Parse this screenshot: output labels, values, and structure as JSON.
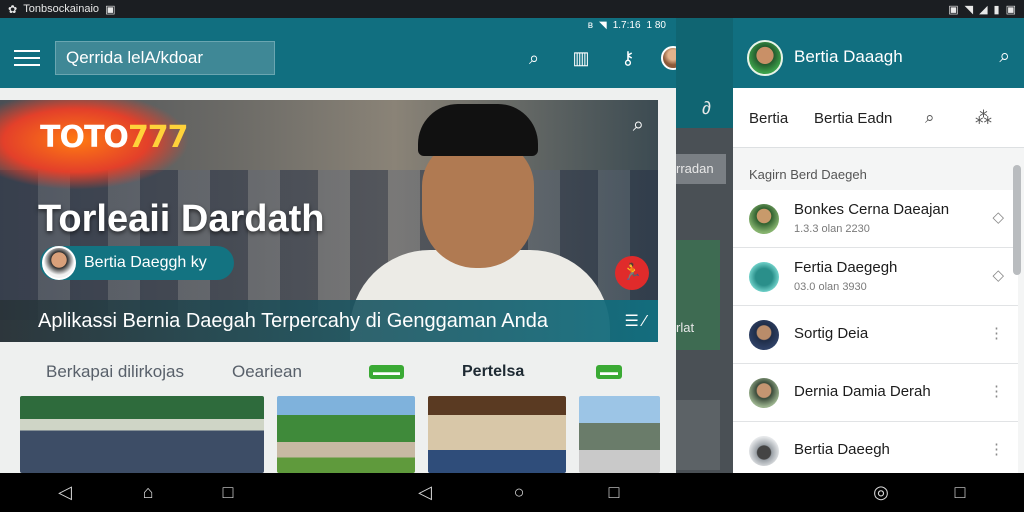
{
  "system_bar": {
    "app_label": "Tonbsockainaio",
    "right_icons": [
      "alarm-icon",
      "wifi-icon",
      "signal-icon",
      "battery-icon"
    ]
  },
  "left_app": {
    "inner_status": {
      "time": "1.7:16",
      "extra": "1 80"
    },
    "search": {
      "text": "Qerrida lelA/kdoar"
    },
    "hero": {
      "logo_text": "TOTO",
      "logo_number": "777",
      "title": "Torleaii Dardath",
      "pill_text": "Bertia Daeggh ky",
      "tagline": "Aplikassi Bernia Daegah Terpercahy di Genggaman Anda"
    },
    "section": {
      "left_label": "Berkapai dilirkojas",
      "left_label_2": "Oeariean",
      "center_label": "Pertelsa"
    },
    "colors": {
      "toolbar": "#116f80",
      "accent_red": "#e02b2b",
      "badge_green": "#3aaa34"
    }
  },
  "sliver": {
    "text_1": "rradan",
    "text_2": "rlat"
  },
  "right_app": {
    "header_title": "Bertia Daaagh",
    "tabs": [
      "Bertia",
      "Bertia Eadn"
    ],
    "section_header": "Kagirn Berd Daegeh",
    "list": [
      {
        "name": "Bonkes Cerna Daeajan",
        "meta": "1.3.3 olan 2230",
        "action_icon": "diamond-icon"
      },
      {
        "name": "Fertia Daegegh",
        "meta": "03.0 olan 3930",
        "action_icon": "diamond-icon"
      },
      {
        "name": "Sortig Deia",
        "meta": "",
        "action_icon": "more-vertical-icon"
      },
      {
        "name": "Dernia Damia Derah",
        "meta": "",
        "action_icon": "more-vertical-icon"
      },
      {
        "name": "Bertia Daeegh",
        "meta": "",
        "action_icon": "more-vertical-icon"
      }
    ]
  },
  "nav_bar": {
    "buttons": [
      "back-icon",
      "home-icon",
      "recents-icon",
      "back-icon",
      "home-icon",
      "recents-icon",
      "assistant-icon",
      "recents-icon"
    ]
  }
}
